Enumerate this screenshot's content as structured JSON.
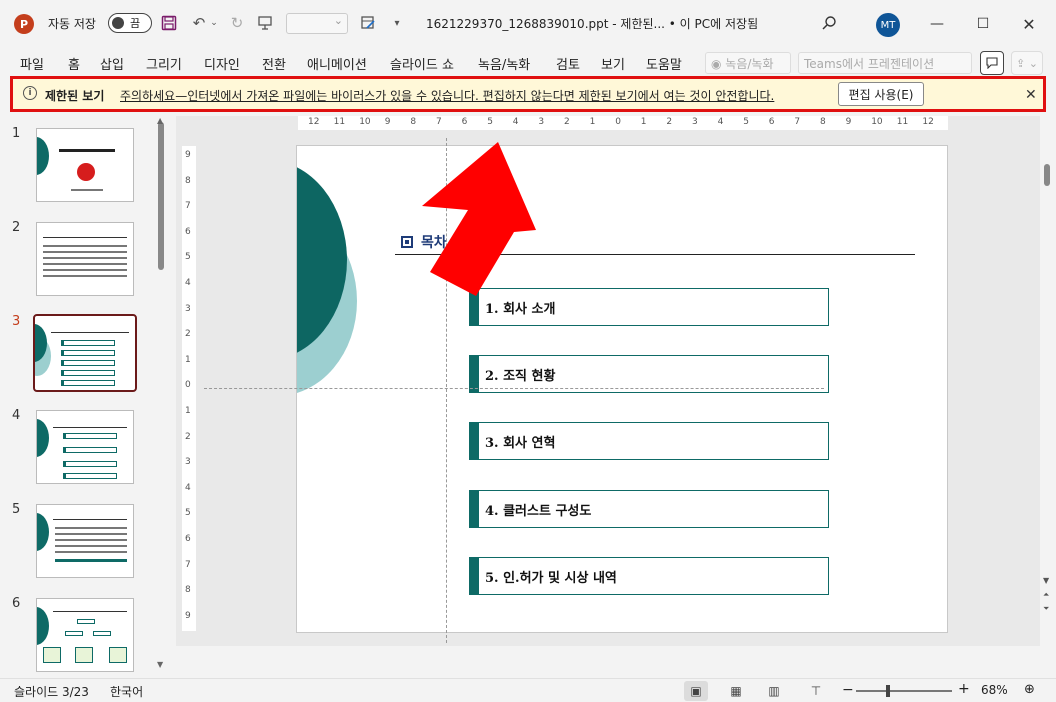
{
  "titlebar": {
    "app_logo": "P",
    "autosave_label": "자동 저장",
    "toggle_label": "끔",
    "doc_title": "1621229370_1268839010.ppt  -  제한된...  •  이 PC에 저장됨",
    "avatar": "MT",
    "icons": [
      "save-icon",
      "undo-icon",
      "redo-icon",
      "present-icon",
      "draw-icon",
      "search-icon"
    ]
  },
  "ribbon": {
    "tabs": [
      "파일",
      "홈",
      "삽입",
      "그리기",
      "디자인",
      "전환",
      "애니메이션",
      "슬라이드 쇼",
      "녹음/녹화",
      "검토",
      "보기",
      "도움말"
    ],
    "record_label": "◉ 녹음/녹화",
    "teams_label": "Teams에서 프레젠테이션"
  },
  "protected_view": {
    "title": "제한된 보기",
    "message": "주의하세요—인터넷에서 가져온 파일에는 바이러스가 있을 수 있습니다. 편집하지 않는다면 제한된 보기에서 여는 것이 안전합니다.",
    "edit_button": "편집 사용(E)",
    "close": "✕"
  },
  "thumbnails": {
    "numbers": [
      "1",
      "2",
      "3",
      "4",
      "5",
      "6"
    ],
    "active": "3"
  },
  "ruler": {
    "h_labels": [
      "12",
      "11",
      "10",
      "9",
      "8",
      "7",
      "6",
      "5",
      "4",
      "3",
      "2",
      "1",
      "0",
      "1",
      "2",
      "3",
      "4",
      "5",
      "6",
      "7",
      "8",
      "9",
      "10",
      "11",
      "12"
    ],
    "v_labels": [
      "9",
      "8",
      "7",
      "6",
      "5",
      "4",
      "3",
      "2",
      "1",
      "0",
      "1",
      "2",
      "3",
      "4",
      "5",
      "6",
      "7",
      "8",
      "9"
    ]
  },
  "slide": {
    "toc_title": "목차",
    "items": [
      "1.   회사 소개",
      "2.   조직 현황",
      "3.   회사 연혁",
      "4.   클러스트 구성도",
      "5.   인.허가 및 시상 내역"
    ],
    "colors": {
      "dark_teal": "#0d6662",
      "light_teal": "#9ccfd0",
      "arrow": "#ff0000",
      "highlight": "#e01010"
    }
  },
  "status": {
    "slide_counter": "슬라이드 3/23",
    "language": "한국어",
    "zoom": "68%",
    "zoom_minus": "−",
    "zoom_plus": "+"
  }
}
